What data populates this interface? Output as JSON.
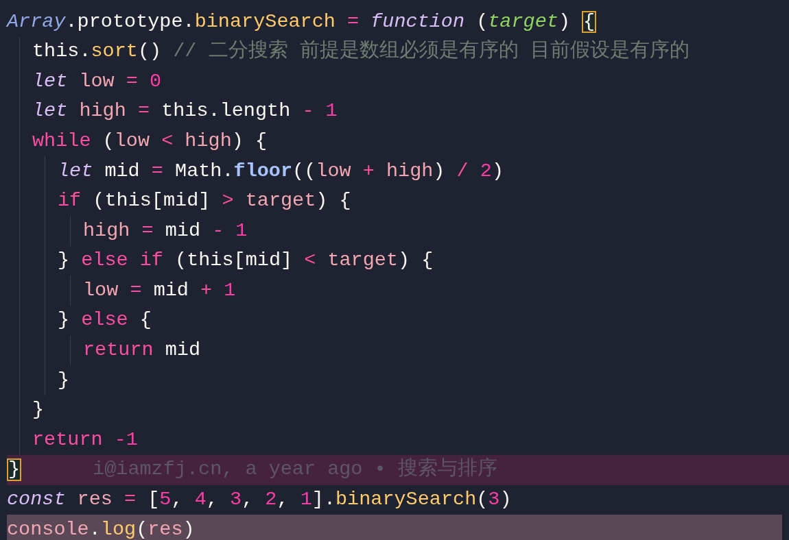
{
  "editor": {
    "lines": [
      {
        "selected": false,
        "current": false,
        "tokens": [
          {
            "t": "Array",
            "kind": "class"
          },
          {
            "t": ".prototype.",
            "kind": "plain"
          },
          {
            "t": "binarySearch",
            "kind": "fn"
          },
          {
            "t": " = ",
            "kind": "op"
          },
          {
            "t": "function",
            "kind": "kw"
          },
          {
            "t": " (",
            "kind": "plain"
          },
          {
            "t": "target",
            "kind": "param"
          },
          {
            "t": ") ",
            "kind": "plain"
          },
          {
            "t": "{",
            "kind": "brace"
          }
        ],
        "children": [
          {
            "selected": false,
            "current": false,
            "tokens": [
              {
                "t": "this.",
                "kind": "plain"
              },
              {
                "t": "sort",
                "kind": "fn"
              },
              {
                "t": "() ",
                "kind": "plain"
              },
              {
                "t": "// 二分搜索 前提是数组必须是有序的 目前假设是有序的",
                "kind": "comment"
              }
            ]
          },
          {
            "selected": false,
            "current": false,
            "tokens": [
              {
                "t": "let",
                "kind": "kw"
              },
              {
                "t": " low",
                "kind": "var"
              },
              {
                "t": " = ",
                "kind": "op"
              },
              {
                "t": "0",
                "kind": "num"
              }
            ]
          },
          {
            "selected": false,
            "current": false,
            "tokens": [
              {
                "t": "let",
                "kind": "kw"
              },
              {
                "t": " high",
                "kind": "var"
              },
              {
                "t": " = ",
                "kind": "op"
              },
              {
                "t": "this.length",
                "kind": "plain"
              },
              {
                "t": " - ",
                "kind": "op"
              },
              {
                "t": "1",
                "kind": "num"
              }
            ]
          },
          {
            "selected": false,
            "current": false,
            "tokens": [
              {
                "t": "while",
                "kind": "ctrl"
              },
              {
                "t": " (",
                "kind": "plain"
              },
              {
                "t": "low",
                "kind": "var"
              },
              {
                "t": " < ",
                "kind": "op"
              },
              {
                "t": "high",
                "kind": "var"
              },
              {
                "t": ") {",
                "kind": "plain"
              }
            ],
            "children": [
              {
                "selected": false,
                "current": false,
                "tokens": [
                  {
                    "t": "let",
                    "kind": "kw"
                  },
                  {
                    "t": " mid ",
                    "kind": "plain"
                  },
                  {
                    "t": "= ",
                    "kind": "op"
                  },
                  {
                    "t": "Math.",
                    "kind": "plain"
                  },
                  {
                    "t": "floor",
                    "kind": "method"
                  },
                  {
                    "t": "((",
                    "kind": "plain"
                  },
                  {
                    "t": "low",
                    "kind": "var"
                  },
                  {
                    "t": " + ",
                    "kind": "op"
                  },
                  {
                    "t": "high",
                    "kind": "var"
                  },
                  {
                    "t": ")",
                    "kind": "plain"
                  },
                  {
                    "t": " / ",
                    "kind": "op"
                  },
                  {
                    "t": "2",
                    "kind": "num"
                  },
                  {
                    "t": ")",
                    "kind": "plain"
                  }
                ]
              },
              {
                "selected": false,
                "current": false,
                "tokens": [
                  {
                    "t": "if",
                    "kind": "ctrl"
                  },
                  {
                    "t": " (this[mid] ",
                    "kind": "plain"
                  },
                  {
                    "t": "> ",
                    "kind": "op"
                  },
                  {
                    "t": "target",
                    "kind": "var"
                  },
                  {
                    "t": ") {",
                    "kind": "plain"
                  }
                ],
                "children": [
                  {
                    "selected": false,
                    "current": false,
                    "tokens": [
                      {
                        "t": "high",
                        "kind": "var"
                      },
                      {
                        "t": " = ",
                        "kind": "op"
                      },
                      {
                        "t": "mid",
                        "kind": "plain"
                      },
                      {
                        "t": " - ",
                        "kind": "op"
                      },
                      {
                        "t": "1",
                        "kind": "num"
                      }
                    ]
                  }
                ]
              },
              {
                "selected": false,
                "current": false,
                "tokens": [
                  {
                    "t": "} ",
                    "kind": "plain"
                  },
                  {
                    "t": "else if",
                    "kind": "ctrl"
                  },
                  {
                    "t": " (this[mid] ",
                    "kind": "plain"
                  },
                  {
                    "t": "< ",
                    "kind": "op"
                  },
                  {
                    "t": "target",
                    "kind": "var"
                  },
                  {
                    "t": ") {",
                    "kind": "plain"
                  }
                ],
                "children": [
                  {
                    "selected": false,
                    "current": false,
                    "tokens": [
                      {
                        "t": "low",
                        "kind": "var"
                      },
                      {
                        "t": " = ",
                        "kind": "op"
                      },
                      {
                        "t": "mid",
                        "kind": "plain"
                      },
                      {
                        "t": " + ",
                        "kind": "op"
                      },
                      {
                        "t": "1",
                        "kind": "num"
                      }
                    ]
                  }
                ]
              },
              {
                "selected": false,
                "current": false,
                "tokens": [
                  {
                    "t": "} ",
                    "kind": "plain"
                  },
                  {
                    "t": "else",
                    "kind": "ctrl"
                  },
                  {
                    "t": " {",
                    "kind": "plain"
                  }
                ],
                "children": [
                  {
                    "selected": false,
                    "current": false,
                    "tokens": [
                      {
                        "t": "return",
                        "kind": "ctrl"
                      },
                      {
                        "t": " mid",
                        "kind": "plain"
                      }
                    ]
                  }
                ]
              },
              {
                "selected": false,
                "current": false,
                "tokens": [
                  {
                    "t": "}",
                    "kind": "plain"
                  }
                ]
              }
            ]
          },
          {
            "selected": false,
            "current": false,
            "tokens": [
              {
                "t": "}",
                "kind": "plain"
              }
            ]
          },
          {
            "selected": false,
            "current": false,
            "tokens": [
              {
                "t": "return",
                "kind": "ctrl"
              },
              {
                "t": " -1",
                "kind": "num"
              }
            ]
          }
        ]
      },
      {
        "selected": false,
        "current": true,
        "tokens": [
          {
            "t": "}",
            "kind": "brace"
          }
        ],
        "blame": "i@iamzfj.cn, a year ago • 搜索与排序"
      },
      {
        "selected": false,
        "current": false,
        "tokens": [
          {
            "t": "const",
            "kind": "kw"
          },
          {
            "t": " res",
            "kind": "var"
          },
          {
            "t": " = ",
            "kind": "op"
          },
          {
            "t": "[",
            "kind": "plain"
          },
          {
            "t": "5",
            "kind": "num"
          },
          {
            "t": ", ",
            "kind": "plain"
          },
          {
            "t": "4",
            "kind": "num"
          },
          {
            "t": ", ",
            "kind": "plain"
          },
          {
            "t": "3",
            "kind": "num"
          },
          {
            "t": ", ",
            "kind": "plain"
          },
          {
            "t": "2",
            "kind": "num"
          },
          {
            "t": ", ",
            "kind": "plain"
          },
          {
            "t": "1",
            "kind": "num"
          },
          {
            "t": "].",
            "kind": "plain"
          },
          {
            "t": "binarySearch",
            "kind": "fn"
          },
          {
            "t": "(",
            "kind": "plain"
          },
          {
            "t": "3",
            "kind": "num"
          },
          {
            "t": ")",
            "kind": "plain"
          }
        ]
      },
      {
        "selected": true,
        "current": false,
        "tokens": [
          {
            "t": "console",
            "kind": "var"
          },
          {
            "t": ".",
            "kind": "plain"
          },
          {
            "t": "log",
            "kind": "fn"
          },
          {
            "t": "(",
            "kind": "plain"
          },
          {
            "t": "res",
            "kind": "var"
          },
          {
            "t": ")",
            "kind": "plain"
          }
        ]
      }
    ]
  }
}
